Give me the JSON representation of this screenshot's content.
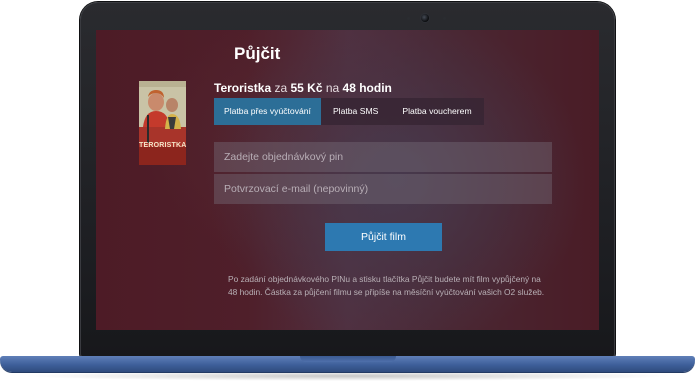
{
  "page": {
    "title": "Půjčit"
  },
  "movie": {
    "title": "Teroristka",
    "poster_caption": "TERORISTKA",
    "price_prefix": " za ",
    "price": "55 Kč",
    "duration_prefix": " na ",
    "duration": "48 hodin"
  },
  "tabs": [
    {
      "label": "Platba přes vyúčtování",
      "active": true
    },
    {
      "label": "Platba SMS",
      "active": false
    },
    {
      "label": "Platba voucherem",
      "active": false
    }
  ],
  "form": {
    "pin_placeholder": "Zadejte objednávkový pin",
    "email_placeholder": "Potvrzovací e-mail (nepovinný)",
    "submit_label": "Půjčit film"
  },
  "info": {
    "text": "Po zadání objednávkového PINu a stisku tlačítka Půjčit budete mít film vypůjčený na 48 hodin. Částka za půjčení filmu se připíše na měsíční vyúčtování vašich O2 služeb."
  },
  "colors": {
    "accent": "#2d79b1",
    "active_tab": "#2c6e97",
    "laptop_base": "#3e5f9a",
    "bezel": "#1d1e22"
  }
}
